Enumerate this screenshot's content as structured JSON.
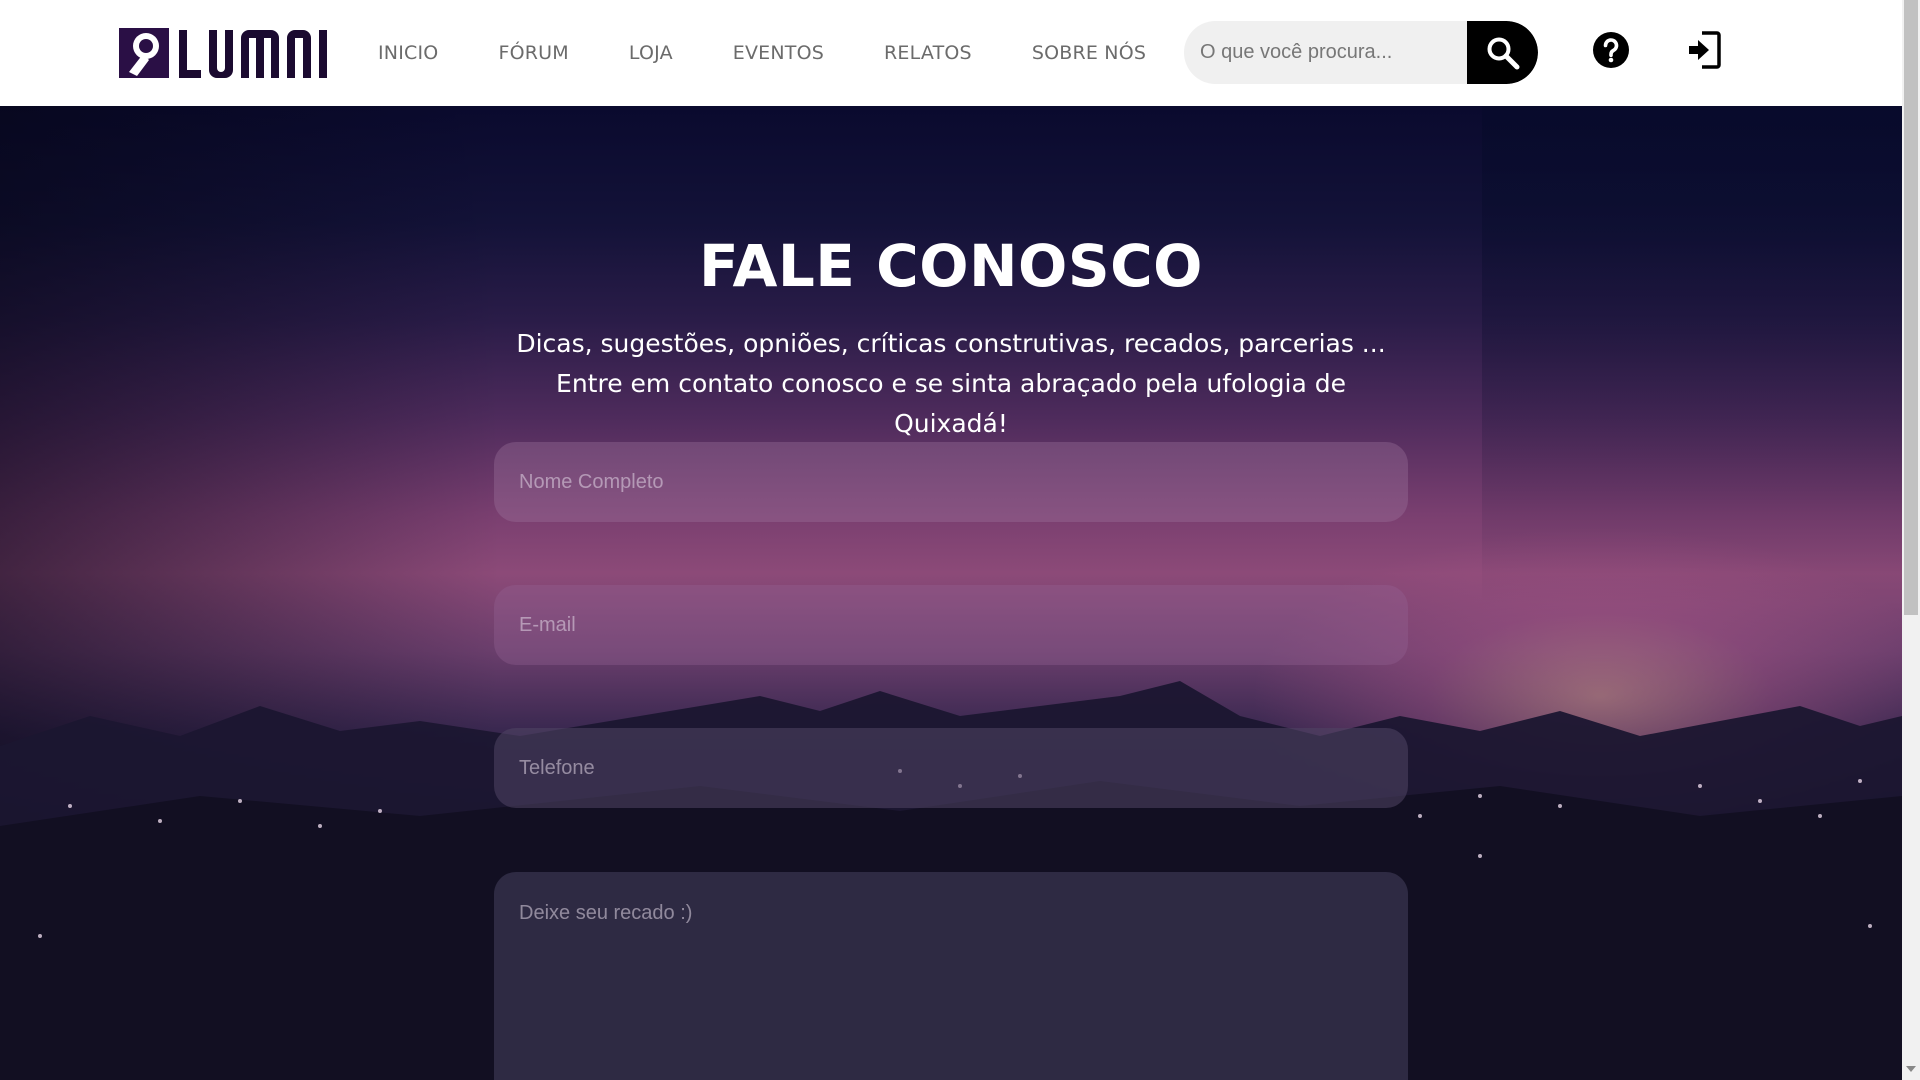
{
  "brand": {
    "logo_text": "LUMNI"
  },
  "nav": {
    "items": [
      {
        "label": "INICIO"
      },
      {
        "label": "FÓRUM"
      },
      {
        "label": "LOJA"
      },
      {
        "label": "EVENTOS"
      },
      {
        "label": "RELATOS"
      },
      {
        "label": "SOBRE NÓS"
      }
    ]
  },
  "search": {
    "placeholder": "O que você procura..."
  },
  "icons": {
    "search": "search-icon",
    "help": "help-icon",
    "login": "login-icon"
  },
  "hero": {
    "title": "FALE CONOSCO",
    "subtitle": "Dicas, sugestões, opniões, críticas construtivas, recados, parcerias ... Entre em contato conosco e se sinta abraçado pela ufologia de Quixadá!"
  },
  "form": {
    "name_placeholder": "Nome Completo",
    "email_placeholder": "E-mail",
    "phone_placeholder": "Telefone",
    "message_placeholder": "Deixe seu recado :)"
  },
  "colors": {
    "brand": "#2a0f45",
    "header_bg": "#ffffff",
    "nav_text": "#6b6b6b"
  }
}
